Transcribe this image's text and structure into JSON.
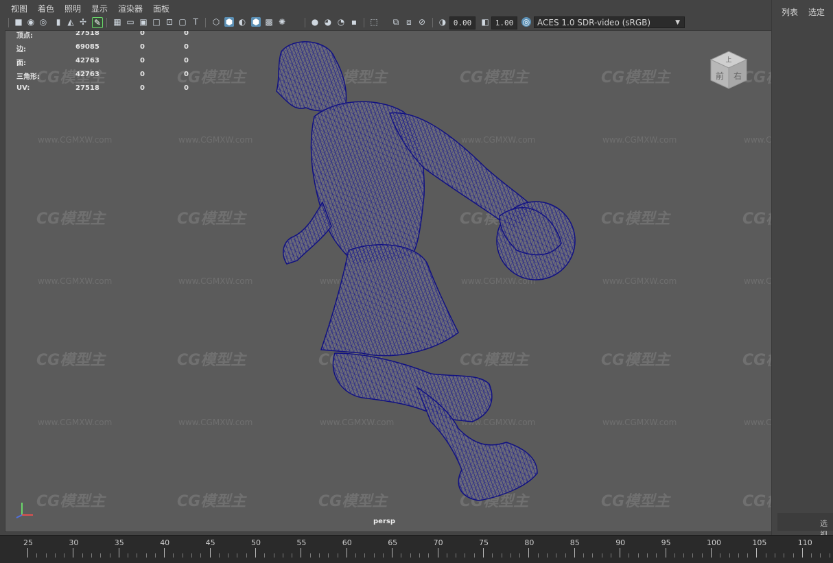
{
  "menubar": {
    "items": [
      "视图",
      "着色",
      "照明",
      "显示",
      "渲染器",
      "面板"
    ]
  },
  "toolbar": {
    "exposure_value": "0.00",
    "gamma_value": "1.00",
    "color_space": "ACES 1.0 SDR-video (sRGB)"
  },
  "hud": {
    "rows": [
      {
        "label": "顶点:",
        "v1": "27518",
        "v2": "0",
        "v3": "0"
      },
      {
        "label": "边:",
        "v1": "69085",
        "v2": "0",
        "v3": "0"
      },
      {
        "label": "面:",
        "v1": "42763",
        "v2": "0",
        "v3": "0"
      },
      {
        "label": "三角形:",
        "v1": "42763",
        "v2": "0",
        "v3": "0"
      },
      {
        "label": "UV:",
        "v1": "27518",
        "v2": "0",
        "v3": "0"
      }
    ]
  },
  "viewport": {
    "camera_label": "persp",
    "viewcube": {
      "top": "上",
      "front": "前",
      "right": "右"
    },
    "watermark_logo": "CG模型主",
    "watermark_url": "www.CGMXW.com",
    "wireframe_color": "#1a1a8c"
  },
  "right_panel": {
    "list_label": "列表",
    "select_label": "选定",
    "bottom_label": "选视"
  },
  "timeline": {
    "ticks": [
      "25",
      "30",
      "35",
      "40",
      "45",
      "50",
      "55",
      "60",
      "65",
      "70",
      "75",
      "80",
      "85",
      "90",
      "95",
      "100",
      "105",
      "110"
    ]
  },
  "colors": {
    "viewport_bg": "#5b5b5b",
    "ui_bg": "#444444",
    "active_icon": "#5b8fb4"
  }
}
